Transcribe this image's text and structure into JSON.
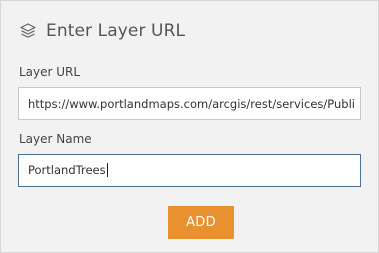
{
  "header": {
    "title": "Enter Layer URL",
    "icon": "layers-icon"
  },
  "form": {
    "url_label": "Layer URL",
    "url_value": "https://www.portlandmaps.com/arcgis/rest/services/Publi",
    "name_label": "Layer Name",
    "name_value": "PortlandTrees"
  },
  "actions": {
    "add_label": "ADD"
  },
  "colors": {
    "panel_bg": "#f2f2f2",
    "button_bg": "#e8912e",
    "focus_border": "#4a6f94"
  }
}
